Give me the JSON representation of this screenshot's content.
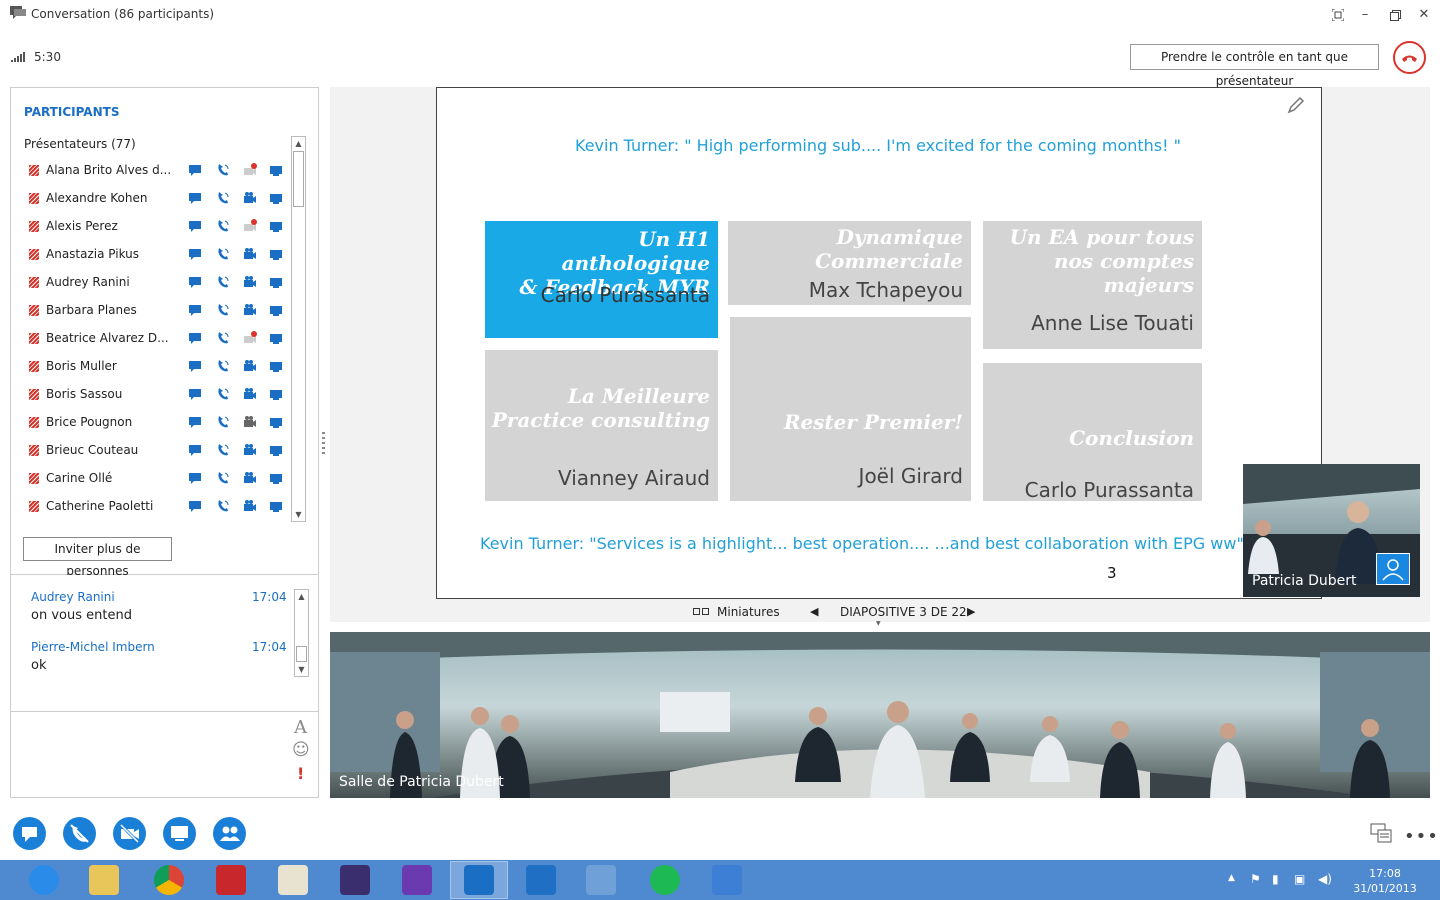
{
  "window": {
    "title": "Conversation (86 participants)",
    "timer": "5:30",
    "take_control_label": "Prendre le contrôle en tant que présentateur"
  },
  "participants": {
    "heading": "PARTICIPANTS",
    "group_label": "Présentateurs (77)",
    "list": [
      {
        "name": "Alana Brito Alves d...",
        "video": "blocked"
      },
      {
        "name": "Alexandre Kohen",
        "video": "on"
      },
      {
        "name": "Alexis Perez",
        "video": "blocked"
      },
      {
        "name": "Anastazia Pikus",
        "video": "on"
      },
      {
        "name": "Audrey Ranini",
        "video": "on"
      },
      {
        "name": "Barbara Planes",
        "video": "on"
      },
      {
        "name": "Beatrice Alvarez D...",
        "video": "blocked"
      },
      {
        "name": "Boris Muller",
        "video": "on"
      },
      {
        "name": "Boris Sassou",
        "video": "on"
      },
      {
        "name": "Brice Pougnon",
        "video": "off"
      },
      {
        "name": "Brieuc Couteau",
        "video": "on"
      },
      {
        "name": "Carine Ollé",
        "video": "on"
      },
      {
        "name": "Catherine Paoletti",
        "video": "on"
      }
    ],
    "invite_label": "Inviter plus de personnes"
  },
  "chat": {
    "messages": [
      {
        "sender": "Audrey Ranini",
        "time": "17:04",
        "text": "on vous entend"
      },
      {
        "sender": "Pierre-Michel Imbern",
        "time": "17:04",
        "text": "ok"
      }
    ]
  },
  "slide": {
    "quote_top": "Kevin Turner: \" High performing sub.... I'm excited for the coming months! \"",
    "quote_bottom": "Kevin Turner: \"Services is a highlight... best operation.... ...and best collaboration with EPG ww\"",
    "page_number": "3",
    "tiles": [
      {
        "title": "Un H1 anthologique\n& Feedback MYR",
        "person": "Carlo Purassanta"
      },
      {
        "title": "Dynamique\nCommerciale",
        "person": "Max Tchapeyou"
      },
      {
        "title": "Un EA pour tous\nnos comptes\nmajeurs",
        "person": "Anne Lise Touati"
      },
      {
        "title": "La Meilleure\nPractice consulting",
        "person": "Vianney Airaud"
      },
      {
        "title": "Rester Premier!",
        "person": "Joël Girard"
      },
      {
        "title": "Conclusion",
        "person": "Carlo Purassanta"
      }
    ]
  },
  "slide_nav": {
    "thumbnails_label": "Miniatures",
    "counter": "DIAPOSITIVE 3 DE 22"
  },
  "presenter_video": {
    "name": "Patricia Dubert"
  },
  "room_video": {
    "name": "Salle de Patricia Dubert"
  },
  "taskbar": {
    "time": "17:08",
    "date": "31/01/2013",
    "apps": [
      "internet-explorer",
      "file-explorer",
      "chrome",
      "zotero",
      "texworks",
      "texmaker",
      "visual-studio",
      "lync",
      "outlook",
      "virtualbox",
      "spotify",
      "snipping"
    ]
  },
  "colors": {
    "accent": "#1a6fc4",
    "slide_highlight": "#19a9e6",
    "hangup": "#d9342b",
    "taskbar": "#4f8ad0"
  }
}
